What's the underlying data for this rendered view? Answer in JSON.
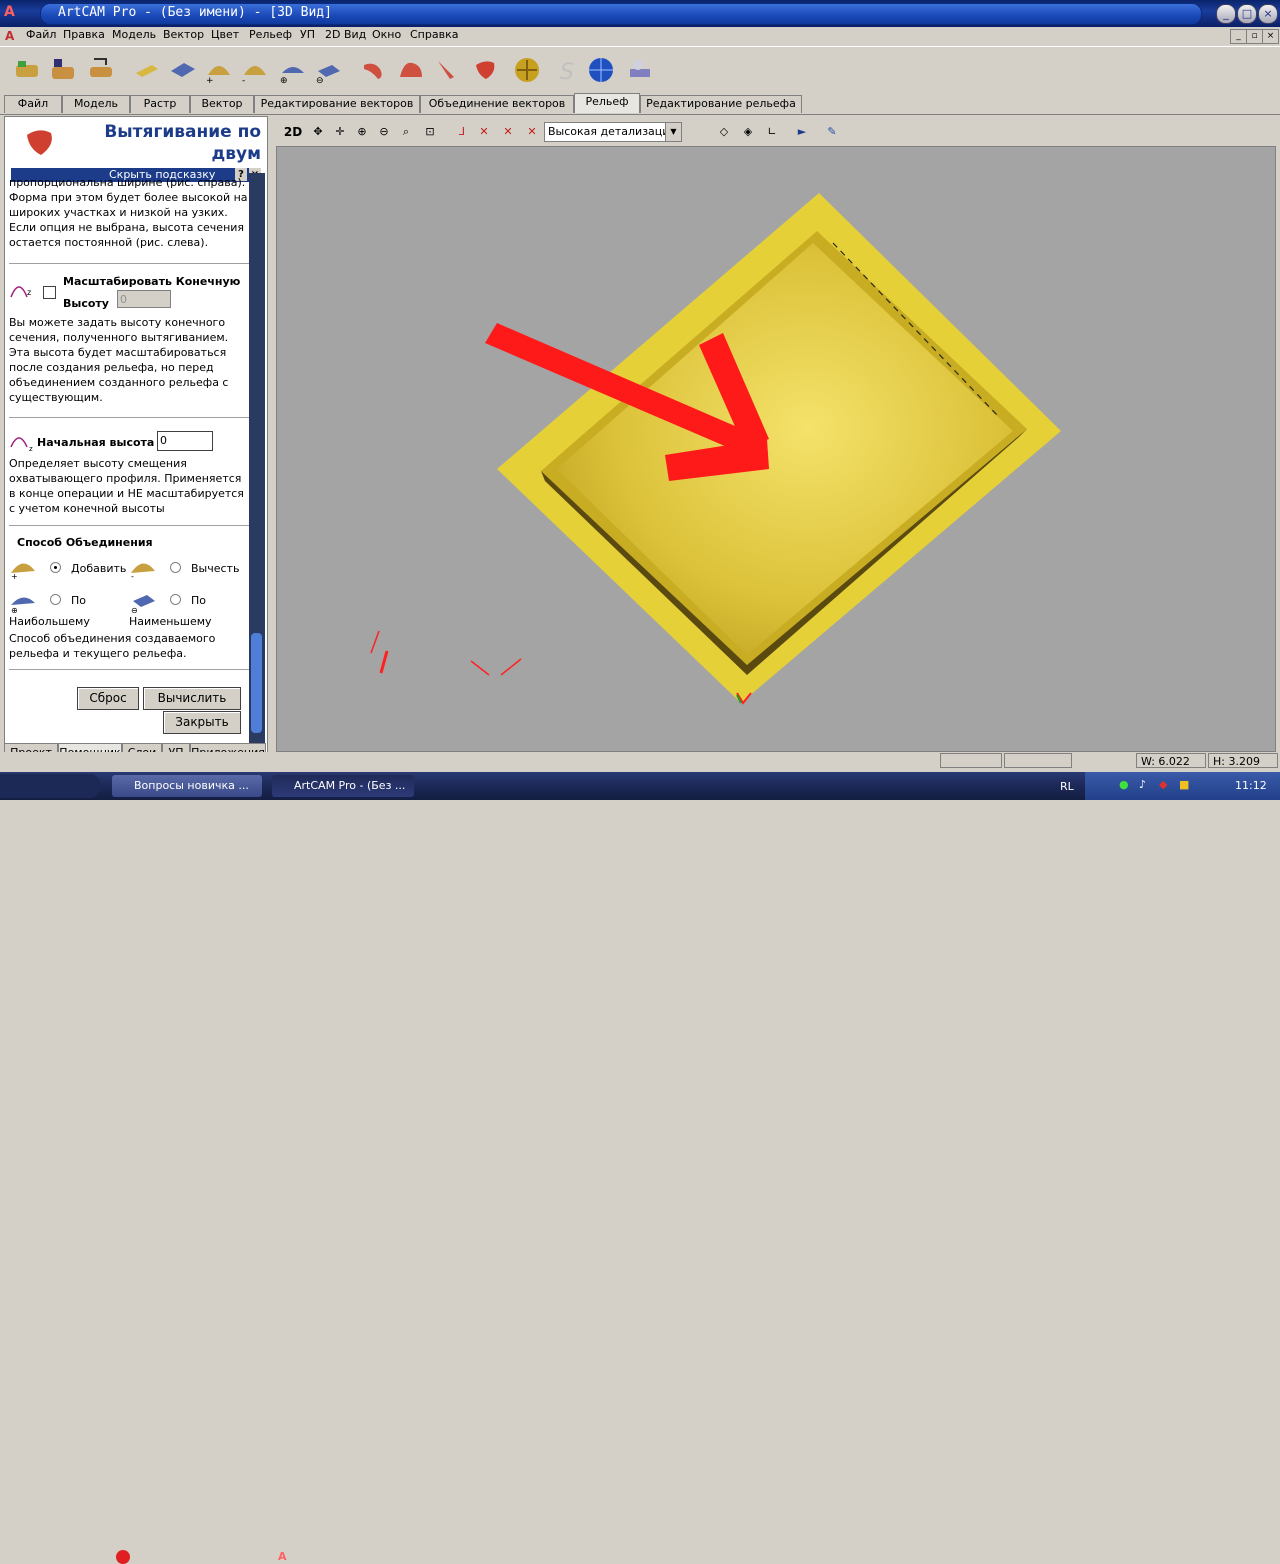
{
  "window": {
    "title": "ArtCAM Pro - (Без имени) - [3D Вид]"
  },
  "menu": [
    "Файл",
    "Правка",
    "Модель",
    "Вектор",
    "Цвет",
    "Рельеф",
    "УП",
    "2D Вид",
    "Окно",
    "Справка"
  ],
  "tabs": [
    {
      "label": "Файл"
    },
    {
      "label": "Модель"
    },
    {
      "label": "Растр"
    },
    {
      "label": "Вектор"
    },
    {
      "label": "Редактирование векторов"
    },
    {
      "label": "Объединение векторов"
    },
    {
      "label": "Рельеф"
    },
    {
      "label": "Редактирование рельефа"
    }
  ],
  "active_tab": "Рельеф",
  "panel": {
    "title": "Вытягивание по двум",
    "hint_bar": "Скрыть подсказку",
    "intro_text": "пропорциональна ширине (рис. справа). Форма при этом будет более высокой на широких участках и низкой на узких. Если опция не выбрана, высота сечения остается постоянной (рис. слева).",
    "scale_label": "Масштабировать Конечную Высоту",
    "scale_value": "0",
    "scale_desc": "Вы можете задать высоту конечного сечения, полученного вытягиванием. Эта высота будет масштабироваться после создания рельефа, но перед объединением созданного рельефа с существующим.",
    "start_height_label": "Начальная высота",
    "start_height_value": "0",
    "start_height_desc": "Определяет высоту смещения охватывающего профиля. Применяется в конце операции и НЕ масштабируется с учетом конечной высоты",
    "combine_title": "Способ Объединения",
    "combine_add": "Добавить",
    "combine_subtract": "Вычесть",
    "combine_max_a": "По",
    "combine_max_b": "Наибольшему",
    "combine_min_a": "По",
    "combine_min_b": "Наименьшему",
    "combine_selected": "Добавить",
    "combine_desc": "Способ объединения создаваемого рельефа и текущего рельефа.",
    "reset_button": "Сброс",
    "calc_button": "Вычислить",
    "close_button": "Закрыть"
  },
  "bottom_tabs": [
    "Проект",
    "Помощник",
    "Слои",
    "УП",
    "Приложения"
  ],
  "active_bottom_tab": "Помощник",
  "view_toolbar": {
    "mode_label": "2D",
    "detail_select": "Высокая детализация"
  },
  "status": {
    "w": "W: 6.022",
    "h": "H: 3.209"
  },
  "taskbar": {
    "tasks": [
      "Вопросы новичка ...",
      "ArtCAM Pro - (Без ..."
    ],
    "lang": "RL",
    "clock": "11:12"
  },
  "colors": {
    "relief": "#e8d23a",
    "arrow": "#ff1a1a",
    "viewport_bg": "#a4a4a4"
  }
}
